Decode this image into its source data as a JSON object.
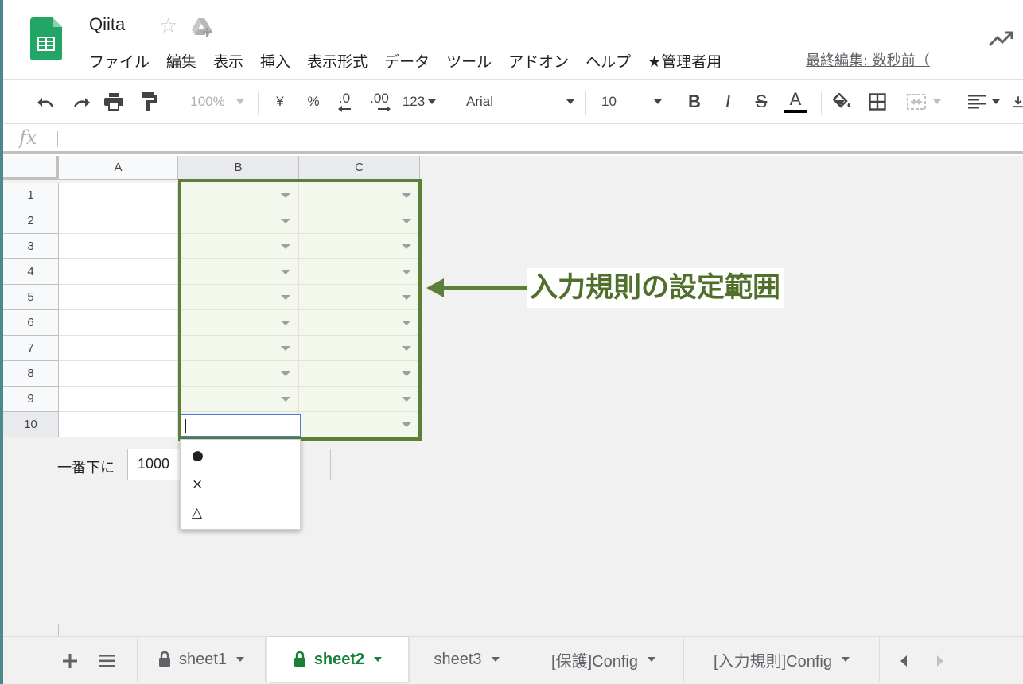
{
  "header": {
    "title": "Qiita",
    "menu": [
      "ファイル",
      "編集",
      "表示",
      "挿入",
      "表示形式",
      "データ",
      "ツール",
      "アドオン",
      "ヘルプ",
      "★管理者用"
    ],
    "last_edit": "最終編集: 数秒前（"
  },
  "toolbar": {
    "zoom": "100%",
    "currency": "¥",
    "percent": "%",
    "decrease_decimal": ".0",
    "increase_decimal": ".00",
    "more_formats": "123",
    "font": "Arial",
    "font_size": "10"
  },
  "formula_bar": {
    "fx": "fx"
  },
  "grid": {
    "columns": [
      "A",
      "B",
      "C"
    ],
    "rows": [
      "1",
      "2",
      "3",
      "4",
      "5",
      "6",
      "7",
      "8",
      "9",
      "10"
    ]
  },
  "annotation": {
    "label": "入力規則の設定範囲"
  },
  "add_rows": {
    "label": "一番下に",
    "value": "1000"
  },
  "dropdown": {
    "options": [
      "●",
      "×",
      "△"
    ]
  },
  "sheets": [
    {
      "name": "sheet1",
      "locked": true,
      "active": false
    },
    {
      "name": "sheet2",
      "locked": true,
      "active": true
    },
    {
      "name": "sheet3",
      "locked": false,
      "active": false
    },
    {
      "name": "[保護]Config",
      "locked": false,
      "active": false
    },
    {
      "name": "[入力規則]Config",
      "locked": false,
      "active": false
    }
  ],
  "colors": {
    "sheets_green": "#188038",
    "annotation_green": "#5c7f3a",
    "validation_fill": "#f3f7ec",
    "active_cell_border": "#4a7fd4"
  }
}
